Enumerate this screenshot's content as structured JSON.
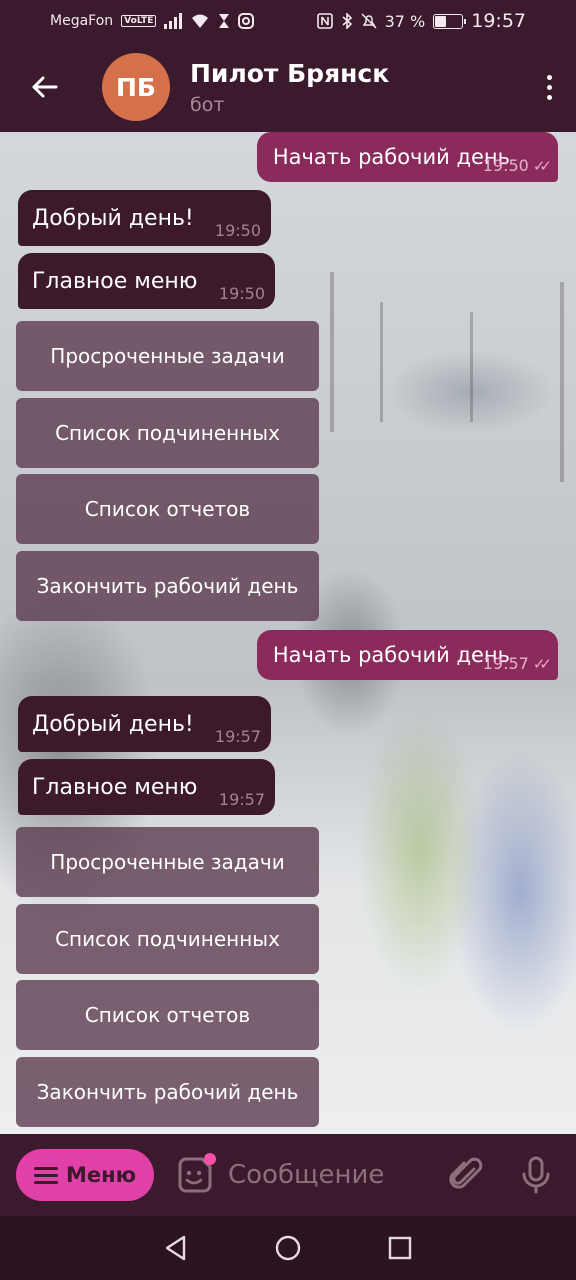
{
  "status_bar": {
    "carrier": "MegaFon",
    "volte": "VoLTE",
    "battery": "37 %",
    "battery_level": 0.37,
    "time": "19:57"
  },
  "header": {
    "avatar_initials": "ПБ",
    "title": "Пилот Брянск",
    "subtitle": "бот"
  },
  "messages": [
    {
      "dir": "out",
      "text": "Начать рабочий день",
      "time": "19:50"
    },
    {
      "dir": "in",
      "text": "Добрый день!",
      "time": "19:50"
    },
    {
      "dir": "in",
      "text": "Главное меню",
      "time": "19:50"
    },
    {
      "dir": "out",
      "text": "Начать рабочий день",
      "time": "19:57"
    },
    {
      "dir": "in",
      "text": "Добрый день!",
      "time": "19:57"
    },
    {
      "dir": "in",
      "text": "Главное меню",
      "time": "19:57"
    }
  ],
  "keyboard_1": [
    "Просроченные задачи",
    "Список подчиненных",
    "Список отчетов",
    "Закончить рабочий день"
  ],
  "keyboard_2": [
    "Просроченные задачи",
    "Список подчиненных",
    "Список отчетов",
    "Закончить рабочий день"
  ],
  "input": {
    "menu_label": "Меню",
    "placeholder": "Сообщение"
  },
  "colors": {
    "header_bg": "#3a1a2c",
    "outgoing_bubble": "#8a2b5c",
    "incoming_bubble": "#3d1a2b",
    "menu_button": "#e040a8"
  }
}
